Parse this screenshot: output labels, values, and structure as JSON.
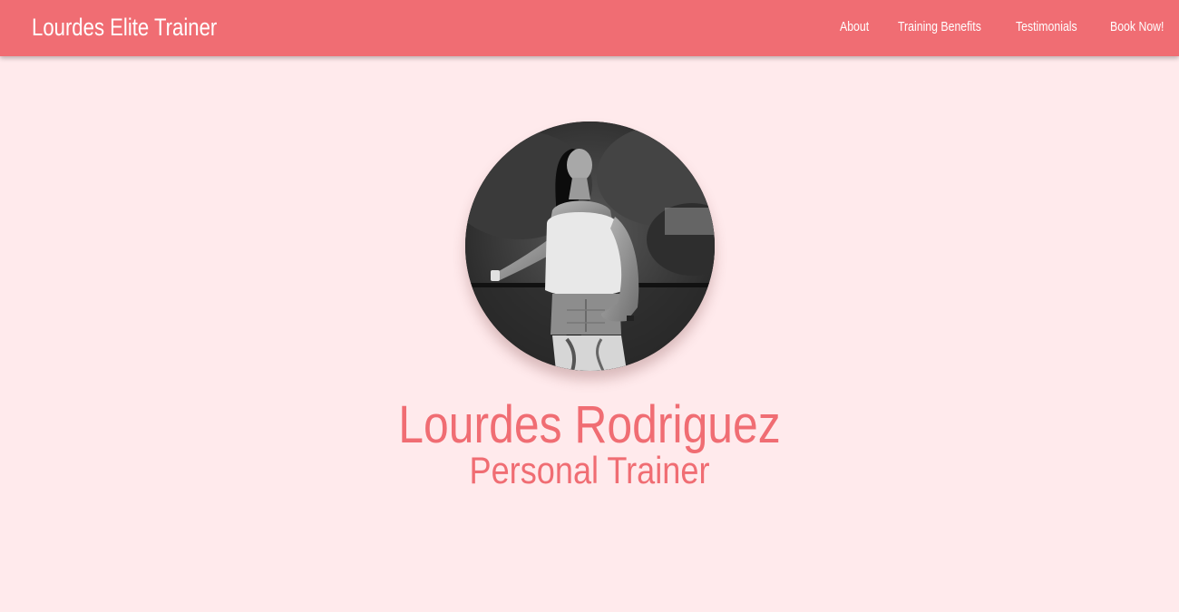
{
  "header": {
    "brand": "Lourdes Elite Trainer",
    "nav": [
      {
        "label": "About"
      },
      {
        "label": "Training Benefits"
      },
      {
        "label": "Testimonials"
      },
      {
        "label": "Book Now!"
      }
    ]
  },
  "hero": {
    "name": "Lourdes Rodriguez",
    "title": "Personal Trainer"
  },
  "colors": {
    "accent": "#f06d73",
    "background": "#ffeaec",
    "nav_text": "#ffffff"
  }
}
